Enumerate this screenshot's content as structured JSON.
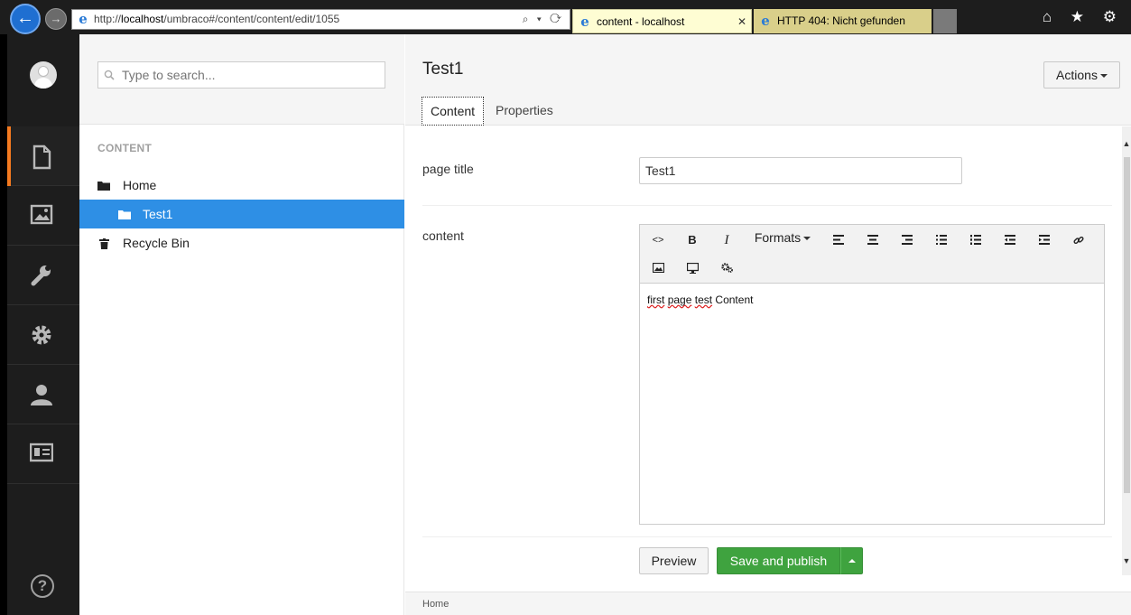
{
  "browser": {
    "url_prefix": "http://",
    "url_host": "localhost",
    "url_path": "/umbraco#/content/content/edit/1055",
    "address_tools": "⌕ ▾ ⟳",
    "tabs": [
      {
        "title": "content - localhost",
        "close": "✕"
      },
      {
        "title": "HTTP 404: Nicht gefunden"
      }
    ],
    "toolbar_icons": "⌂ ★ ⚙",
    "back": "←",
    "forward": "→"
  },
  "tree": {
    "search_placeholder": "Type to search...",
    "section_label": "CONTENT",
    "items": [
      {
        "label": "Home"
      },
      {
        "label": "Test1"
      },
      {
        "label": "Recycle Bin"
      }
    ]
  },
  "sections": {
    "help": "?"
  },
  "editor": {
    "page_name": "Test1",
    "actions_label": "Actions",
    "tabs": [
      {
        "label": "Content"
      },
      {
        "label": "Properties"
      }
    ],
    "properties": {
      "page_title_label": "page title",
      "page_title_value": "Test1",
      "content_label": "content"
    },
    "rte": {
      "formats_label": "Formats",
      "code_label": "<>",
      "bold_label": "B",
      "italic_label": "I",
      "body_word1": "first",
      "body_word2": "page",
      "body_word3": "test",
      "body_word4": "Content"
    },
    "preview_label": "Preview",
    "save_publish_label": "Save and publish",
    "breadcrumb": "Home"
  }
}
